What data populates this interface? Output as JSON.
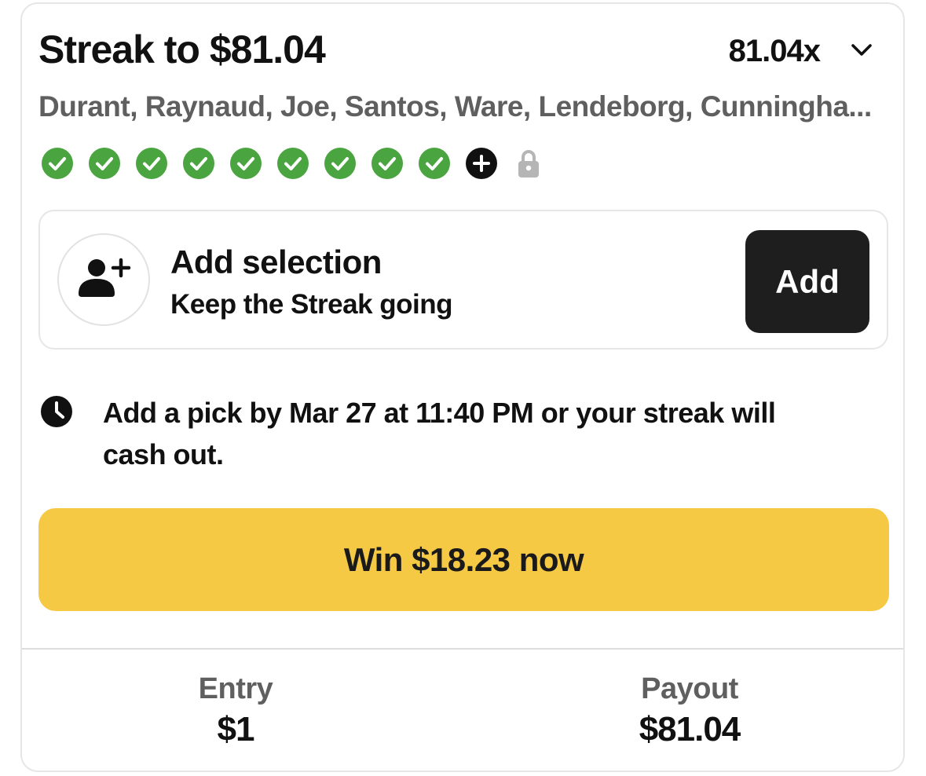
{
  "streak": {
    "title": "Streak to $81.04",
    "multiplier": "81.04x",
    "players": "Durant, Raynaud, Joe, Santos, Ware, Lendeborg, Cunningha..."
  },
  "picks": {
    "completed_count": 9,
    "total_slots": 11,
    "statuses": [
      "check",
      "check",
      "check",
      "check",
      "check",
      "check",
      "check",
      "check",
      "check",
      "add",
      "locked"
    ]
  },
  "add_selection": {
    "title": "Add selection",
    "subtitle": "Keep the Streak going",
    "button_label": "Add"
  },
  "deadline": {
    "text": "Add a pick by Mar 27 at 11:40 PM or your streak will cash out."
  },
  "cashout": {
    "button_label": "Win $18.23 now"
  },
  "summary": {
    "entry_label": "Entry",
    "entry_value": "$1",
    "payout_label": "Payout",
    "payout_value": "$81.04"
  },
  "colors": {
    "check_green": "#4aa43f",
    "cashout_yellow": "#f5c944",
    "add_button_dark": "#1e1e1e",
    "secondary_text": "#5f5f5f",
    "lock_gray": "#b5b5b5"
  },
  "icons": {
    "expand": "chevron-down-icon",
    "avatar": "add-user-icon",
    "deadline": "clock-icon",
    "pick_done": "check-circle-icon",
    "pick_add": "plus-circle-icon",
    "pick_locked": "lock-icon"
  }
}
